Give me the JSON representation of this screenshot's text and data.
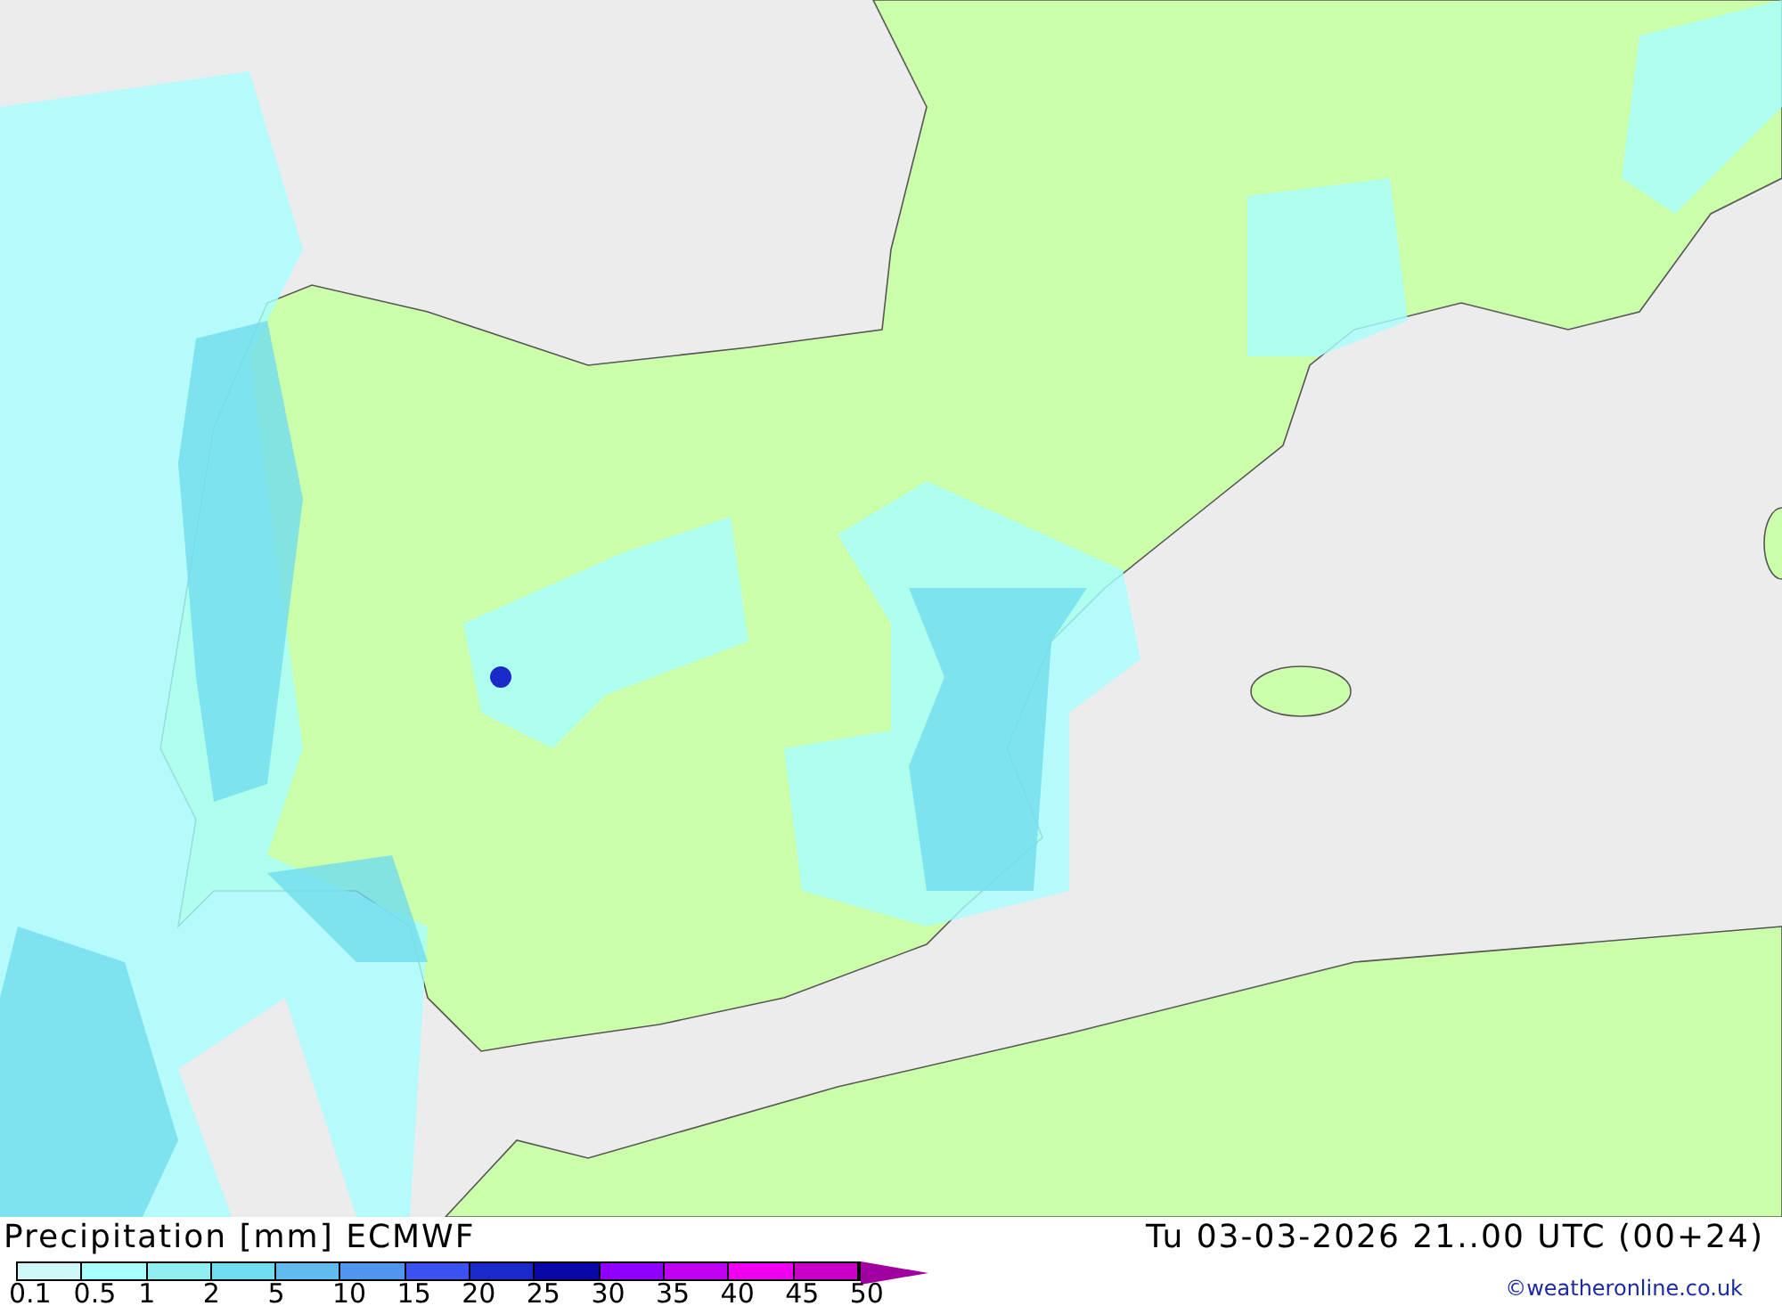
{
  "map": {
    "title": "Precipitation [mm] ECMWF",
    "valid_time": "Tu 03-03-2026 21..00 UTC (00+24)",
    "credit": "©weatheronline.co.uk"
  },
  "legend": {
    "steps": [
      {
        "label": "0.1",
        "color": "#d0f8f8"
      },
      {
        "label": "0.5",
        "color": "#a8ffff"
      },
      {
        "label": "1",
        "color": "#90eeee"
      },
      {
        "label": "2",
        "color": "#70dcee"
      },
      {
        "label": "5",
        "color": "#60bcee"
      },
      {
        "label": "10",
        "color": "#5096ee"
      },
      {
        "label": "15",
        "color": "#3a52f0"
      },
      {
        "label": "20",
        "color": "#1a2ac8"
      },
      {
        "label": "25",
        "color": "#0808a8"
      },
      {
        "label": "30",
        "color": "#9000ff"
      },
      {
        "label": "35",
        "color": "#c000f0"
      },
      {
        "label": "40",
        "color": "#f000f0"
      },
      {
        "label": "45",
        "color": "#c800c8"
      }
    ],
    "last_label": "50"
  }
}
